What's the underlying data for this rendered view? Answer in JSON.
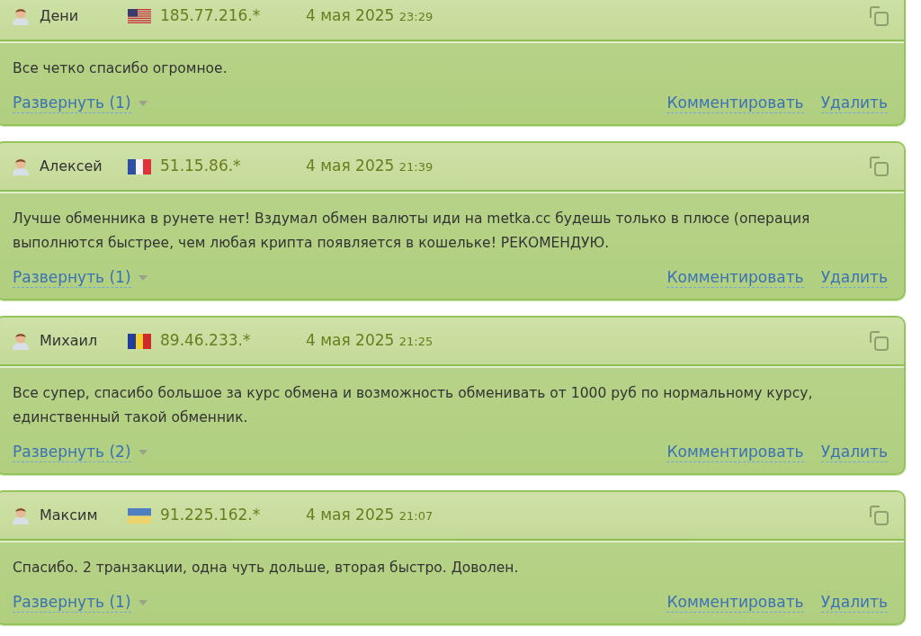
{
  "comments": [
    {
      "author": "Дени",
      "kind": "us",
      "ip": "185.77.216.*",
      "date": "4 мая 2025",
      "time": "23:29",
      "text": "Все четко спасибо огромное.",
      "expand": "Развернуть (1)",
      "comment": "Комментировать",
      "delete": "Удалить"
    },
    {
      "author": "Алексей",
      "kind": "fr",
      "ip": "51.15.86.*",
      "date": "4 мая 2025",
      "time": "21:39",
      "text": "Лучше обменника в рунете нет! Вздумал обмен валюты иди на metka.cc будешь только в плюсе (операция выполнются быстрее, чем любая крипта появляется в кошельке! РЕКОМЕНДУЮ.",
      "expand": "Развернуть (1)",
      "comment": "Комментировать",
      "delete": "Удалить"
    },
    {
      "author": "Михаил",
      "kind": "ro",
      "ip": "89.46.233.*",
      "date": "4 мая 2025",
      "time": "21:25",
      "text": "Все супер, спасибо большое за курс обмена и возможность обменивать от 1000 руб по нормальному курсу, единственный такой обменник.",
      "expand": "Развернуть (2)",
      "comment": "Комментировать",
      "delete": "Удалить"
    },
    {
      "author": "Максим",
      "kind": "ua",
      "ip": "91.225.162.*",
      "date": "4 мая 2025",
      "time": "21:07",
      "text": "Спасибо. 2 транзакции, одна чуть дольше, вторая быстро. Доволен.",
      "expand": "Развернуть (1)",
      "comment": "Комментировать",
      "delete": "Удалить"
    }
  ]
}
